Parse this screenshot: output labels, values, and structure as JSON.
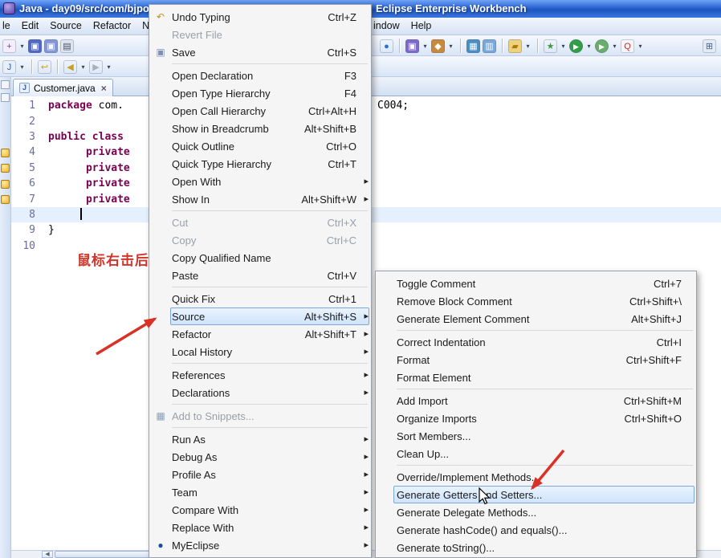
{
  "colors": {
    "titlebar_blue": "#2a63cf",
    "menu_highlight_bg": "#cfe4fb",
    "menu_highlight_border": "#7da7d9",
    "keyword_purple": "#7b0052",
    "annotation_red": "#d2342a",
    "marker_gold": "#f0b428"
  },
  "window": {
    "title_left": "Java - day09/src/com/bjpowe",
    "title_right": "Eclipse Enterprise Workbench"
  },
  "menubar": {
    "left_items": [
      "le",
      "Edit",
      "Source",
      "Refactor",
      "N"
    ],
    "right_items": [
      "indow",
      "Help"
    ]
  },
  "toolbar": {
    "row1_left": [
      {
        "name": "new-wizard-icon",
        "glyph": "+",
        "bg": "#f4eefc",
        "fg": "#6a3fb5"
      },
      {
        "name": "dropdown-arrow-icon",
        "glyph": "▾",
        "arrow": true
      },
      {
        "name": "save-icon",
        "glyph": "▣",
        "bg": "#5068c4",
        "fg": "#ffffff"
      },
      {
        "name": "save-all-icon",
        "glyph": "▣",
        "bg": "#8496d6",
        "fg": "#ffffff"
      },
      {
        "name": "print-icon",
        "glyph": "▤",
        "bg": "#dfe5ee",
        "fg": "#44506a"
      }
    ],
    "row1_right": [
      {
        "name": "web-browser-icon",
        "glyph": "●",
        "bg": "transparent",
        "fg": "#2b6fd4"
      },
      {
        "sep": true,
        "name": "toolbar-separator"
      },
      {
        "name": "deploy-server-icon",
        "glyph": "▣",
        "bg": "#7d68cc",
        "fg": "#ffffff"
      },
      {
        "name": "dropdown-arrow-icon",
        "glyph": "▾",
        "arrow": true
      },
      {
        "name": "database-explorer-icon",
        "glyph": "◆",
        "bg": "#c9893a",
        "fg": "#ffffff"
      },
      {
        "name": "dropdown-arrow-icon",
        "glyph": "▾",
        "arrow": true
      },
      {
        "sep": true,
        "name": "toolbar-separator"
      },
      {
        "name": "report-design-icon",
        "glyph": "▦",
        "bg": "#4b8ec4",
        "fg": "#ffffff"
      },
      {
        "name": "chart-icon",
        "glyph": "▥",
        "bg": "#7aa8d8",
        "fg": "#ffffff"
      },
      {
        "sep": true,
        "name": "toolbar-separator"
      },
      {
        "name": "open-folder-icon",
        "glyph": "▰",
        "bg": "#f0d27a",
        "fg": "#a87a10"
      },
      {
        "name": "dropdown-arrow-icon",
        "glyph": "▾",
        "arrow": true
      },
      {
        "sep": true,
        "name": "toolbar-separator"
      },
      {
        "name": "external-tools-icon",
        "glyph": "★",
        "bg": "transparent",
        "fg": "#3f9a3f"
      },
      {
        "name": "dropdown-arrow-icon",
        "glyph": "▾",
        "arrow": true
      },
      {
        "name": "run-icon",
        "glyph": "▶",
        "bg": "#2f9e44",
        "fg": "#ffffff",
        "round": true
      },
      {
        "name": "dropdown-arrow-icon",
        "glyph": "▾",
        "arrow": true
      },
      {
        "name": "coverage-icon",
        "glyph": "▶",
        "bg": "#68b06a",
        "fg": "#ffffff",
        "round": true
      },
      {
        "name": "dropdown-arrow-icon",
        "glyph": "▾",
        "arrow": true
      },
      {
        "name": "profile-icon",
        "glyph": "Q",
        "bg": "#f4f6fa",
        "fg": "#c03030"
      },
      {
        "name": "dropdown-arrow-icon",
        "glyph": "▾",
        "arrow": true
      }
    ],
    "row1_far": [
      {
        "name": "table-icon",
        "glyph": "⊞",
        "bg": "#e4ebf5",
        "fg": "#44608a"
      }
    ],
    "row2": [
      {
        "name": "java-browsing-icon",
        "glyph": "J",
        "bg": "#e8effa",
        "fg": "#2b5fb4"
      },
      {
        "name": "dropdown-arrow-icon",
        "glyph": "▾",
        "arrow": true
      },
      {
        "sep": true,
        "name": "toolbar-separator"
      },
      {
        "name": "last-edit-location-icon",
        "glyph": "↩",
        "bg": "transparent",
        "fg": "#c8a020"
      },
      {
        "sep": true,
        "name": "toolbar-separator"
      },
      {
        "name": "back-icon",
        "glyph": "◀",
        "bg": "transparent",
        "fg": "#c8a020"
      },
      {
        "name": "dropdown-arrow-icon",
        "glyph": "▾",
        "arrow": true
      },
      {
        "name": "forward-icon",
        "glyph": "▶",
        "bg": "transparent",
        "fg": "#a8b0bc"
      },
      {
        "name": "dropdown-arrow-icon",
        "glyph": "▾",
        "arrow": true
      }
    ]
  },
  "editor": {
    "tab": {
      "label": "Customer.java",
      "close": "×",
      "file_icon": "J"
    },
    "lines": [
      {
        "num": "1",
        "kw": "package",
        "rest": " com."
      },
      {
        "num": "2",
        "kw": "",
        "rest": ""
      },
      {
        "num": "3",
        "kw": "public class",
        "rest": " "
      },
      {
        "num": "4",
        "kw": "      private",
        "rest": ""
      },
      {
        "num": "5",
        "kw": "      private",
        "rest": ""
      },
      {
        "num": "6",
        "kw": "      private",
        "rest": ""
      },
      {
        "num": "7",
        "kw": "      private",
        "rest": ""
      },
      {
        "num": "8",
        "kw": "",
        "rest": "",
        "current": true,
        "cursor": true
      },
      {
        "num": "9",
        "kw": "",
        "rest": "}"
      },
      {
        "num": "10",
        "kw": "",
        "rest": ""
      }
    ],
    "line1_fragment": "C004;",
    "annotation": "鼠标右击后",
    "hscroll_left_arrow": "◀"
  },
  "context_menu": {
    "items": [
      {
        "label": "Undo Typing",
        "shortcut": "Ctrl+Z",
        "icon": "undo-icon"
      },
      {
        "label": "Revert File",
        "disabled": true
      },
      {
        "label": "Save",
        "shortcut": "Ctrl+S",
        "icon": "save-icon"
      },
      {
        "type": "separator"
      },
      {
        "label": "Open Declaration",
        "shortcut": "F3"
      },
      {
        "label": "Open Type Hierarchy",
        "shortcut": "F4"
      },
      {
        "label": "Open Call Hierarchy",
        "shortcut": "Ctrl+Alt+H"
      },
      {
        "label": "Show in Breadcrumb",
        "shortcut": "Alt+Shift+B"
      },
      {
        "label": "Quick Outline",
        "shortcut": "Ctrl+O"
      },
      {
        "label": "Quick Type Hierarchy",
        "shortcut": "Ctrl+T"
      },
      {
        "label": "Open With",
        "submenu": true
      },
      {
        "label": "Show In",
        "shortcut": "Alt+Shift+W",
        "submenu": true
      },
      {
        "type": "separator"
      },
      {
        "label": "Cut",
        "shortcut": "Ctrl+X",
        "disabled": true
      },
      {
        "label": "Copy",
        "shortcut": "Ctrl+C",
        "disabled": true
      },
      {
        "label": "Copy Qualified Name"
      },
      {
        "label": "Paste",
        "shortcut": "Ctrl+V"
      },
      {
        "type": "separator"
      },
      {
        "label": "Quick Fix",
        "shortcut": "Ctrl+1"
      },
      {
        "label": "Source",
        "shortcut": "Alt+Shift+S",
        "submenu": true,
        "highlighted": true
      },
      {
        "label": "Refactor",
        "shortcut": "Alt+Shift+T",
        "submenu": true
      },
      {
        "label": "Local History",
        "submenu": true
      },
      {
        "type": "separator"
      },
      {
        "label": "References",
        "submenu": true
      },
      {
        "label": "Declarations",
        "submenu": true
      },
      {
        "type": "separator"
      },
      {
        "label": "Add to Snippets...",
        "icon": "snippets-icon",
        "disabled": true
      },
      {
        "type": "separator"
      },
      {
        "label": "Run As",
        "submenu": true
      },
      {
        "label": "Debug As",
        "submenu": true
      },
      {
        "label": "Profile As",
        "submenu": true
      },
      {
        "label": "Team",
        "submenu": true
      },
      {
        "label": "Compare With",
        "submenu": true
      },
      {
        "label": "Replace With",
        "submenu": true
      },
      {
        "label": "MyEclipse",
        "submenu": true,
        "icon": "myeclipse-icon"
      }
    ]
  },
  "source_submenu": {
    "items": [
      {
        "label": "Toggle Comment",
        "shortcut": "Ctrl+7"
      },
      {
        "label": "Remove Block Comment",
        "shortcut": "Ctrl+Shift+\\"
      },
      {
        "label": "Generate Element Comment",
        "shortcut": "Alt+Shift+J"
      },
      {
        "type": "separator"
      },
      {
        "label": "Correct Indentation",
        "shortcut": "Ctrl+I"
      },
      {
        "label": "Format",
        "shortcut": "Ctrl+Shift+F"
      },
      {
        "label": "Format Element"
      },
      {
        "type": "separator"
      },
      {
        "label": "Add Import",
        "shortcut": "Ctrl+Shift+M"
      },
      {
        "label": "Organize Imports",
        "shortcut": "Ctrl+Shift+O"
      },
      {
        "label": "Sort Members..."
      },
      {
        "label": "Clean Up..."
      },
      {
        "type": "separator"
      },
      {
        "label": "Override/Implement Methods..."
      },
      {
        "label": "Generate Getters and Setters...",
        "highlighted": true
      },
      {
        "label": "Generate Delegate Methods..."
      },
      {
        "label": "Generate hashCode() and equals()..."
      },
      {
        "label": "Generate toString()..."
      }
    ]
  }
}
